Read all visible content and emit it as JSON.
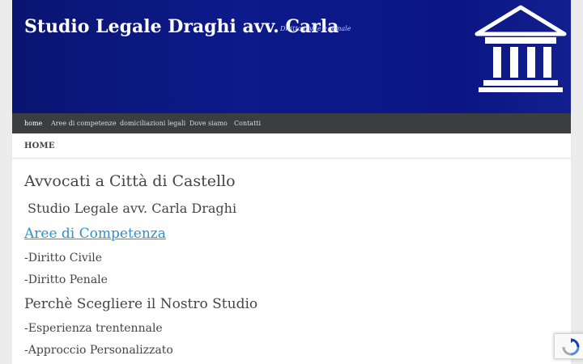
{
  "header": {
    "site_title": "Studio Legale Draghi avv. Carla",
    "tagline": "Diritto civile e penale",
    "logo_icon": "courthouse-icon"
  },
  "nav": {
    "items": [
      {
        "label": "home",
        "active": true
      },
      {
        "label": "Aree di competenze",
        "active": false
      },
      {
        "label": "domiciliazioni legali",
        "active": false
      },
      {
        "label": "Dove siamo",
        "active": false
      },
      {
        "label": "Contatti",
        "active": false
      }
    ]
  },
  "breadcrumb": "HOME",
  "content": {
    "heading": "Avvocati a Città di Castello",
    "subheading": "Studio Legale avv. Carla Draghi",
    "competenze_link": "Aree di Competenza",
    "competenze": [
      "-Diritto Civile",
      "-Diritto Penale"
    ],
    "why_heading": "Perchè Scegliere il Nostro Studio",
    "why_items": [
      "-Esperienza trentennale",
      "-Approccio Personalizzato"
    ]
  },
  "colors": {
    "header_bg": "#0c1a8a",
    "nav_bg": "#3c3d3f",
    "link": "#2f8fc9"
  },
  "recaptcha_icon": "recaptcha-icon"
}
